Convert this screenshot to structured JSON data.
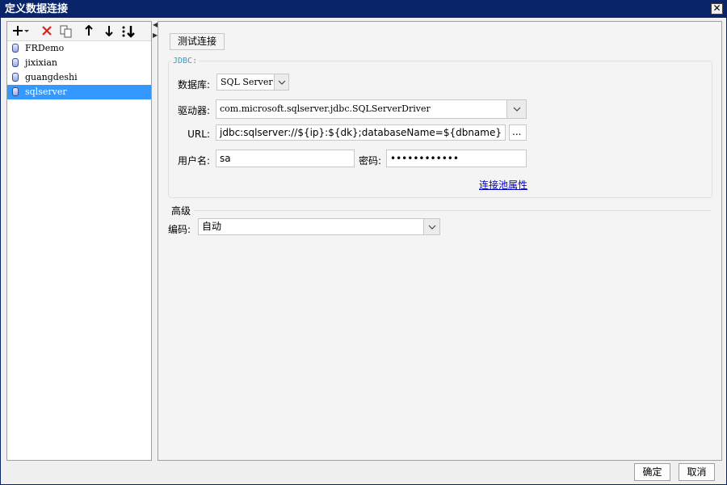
{
  "window": {
    "title": "定义数据连接"
  },
  "toolbar": {
    "icons": [
      "add-icon",
      "delete-icon",
      "copy-icon",
      "move-up-icon",
      "move-down-icon",
      "sort-icon"
    ]
  },
  "connections": [
    {
      "name": "FRDemo",
      "selected": false
    },
    {
      "name": "jixixian",
      "selected": false
    },
    {
      "name": "guangdeshi",
      "selected": false
    },
    {
      "name": "sqlserver",
      "selected": true
    }
  ],
  "main": {
    "test_button": "测试连接",
    "jdbc_legend": "JDBC:",
    "database": {
      "label": "数据库:",
      "value": "SQL Server"
    },
    "driver": {
      "label": "驱动器:",
      "value": "com.microsoft.sqlserver.jdbc.SQLServerDriver"
    },
    "url": {
      "label": "URL:",
      "value": "jdbc:sqlserver://${ip}:${dk};databaseName=${dbname}",
      "browse": "..."
    },
    "username": {
      "label": "用户名:",
      "value": "sa"
    },
    "password": {
      "label": "密码:",
      "value": "••••••••••••"
    },
    "pool_link": "连接池属性",
    "advanced": {
      "title": "高级",
      "encoding_label": "编码:",
      "encoding_value": "自动"
    }
  },
  "footer": {
    "ok": "确定",
    "cancel": "取消"
  }
}
